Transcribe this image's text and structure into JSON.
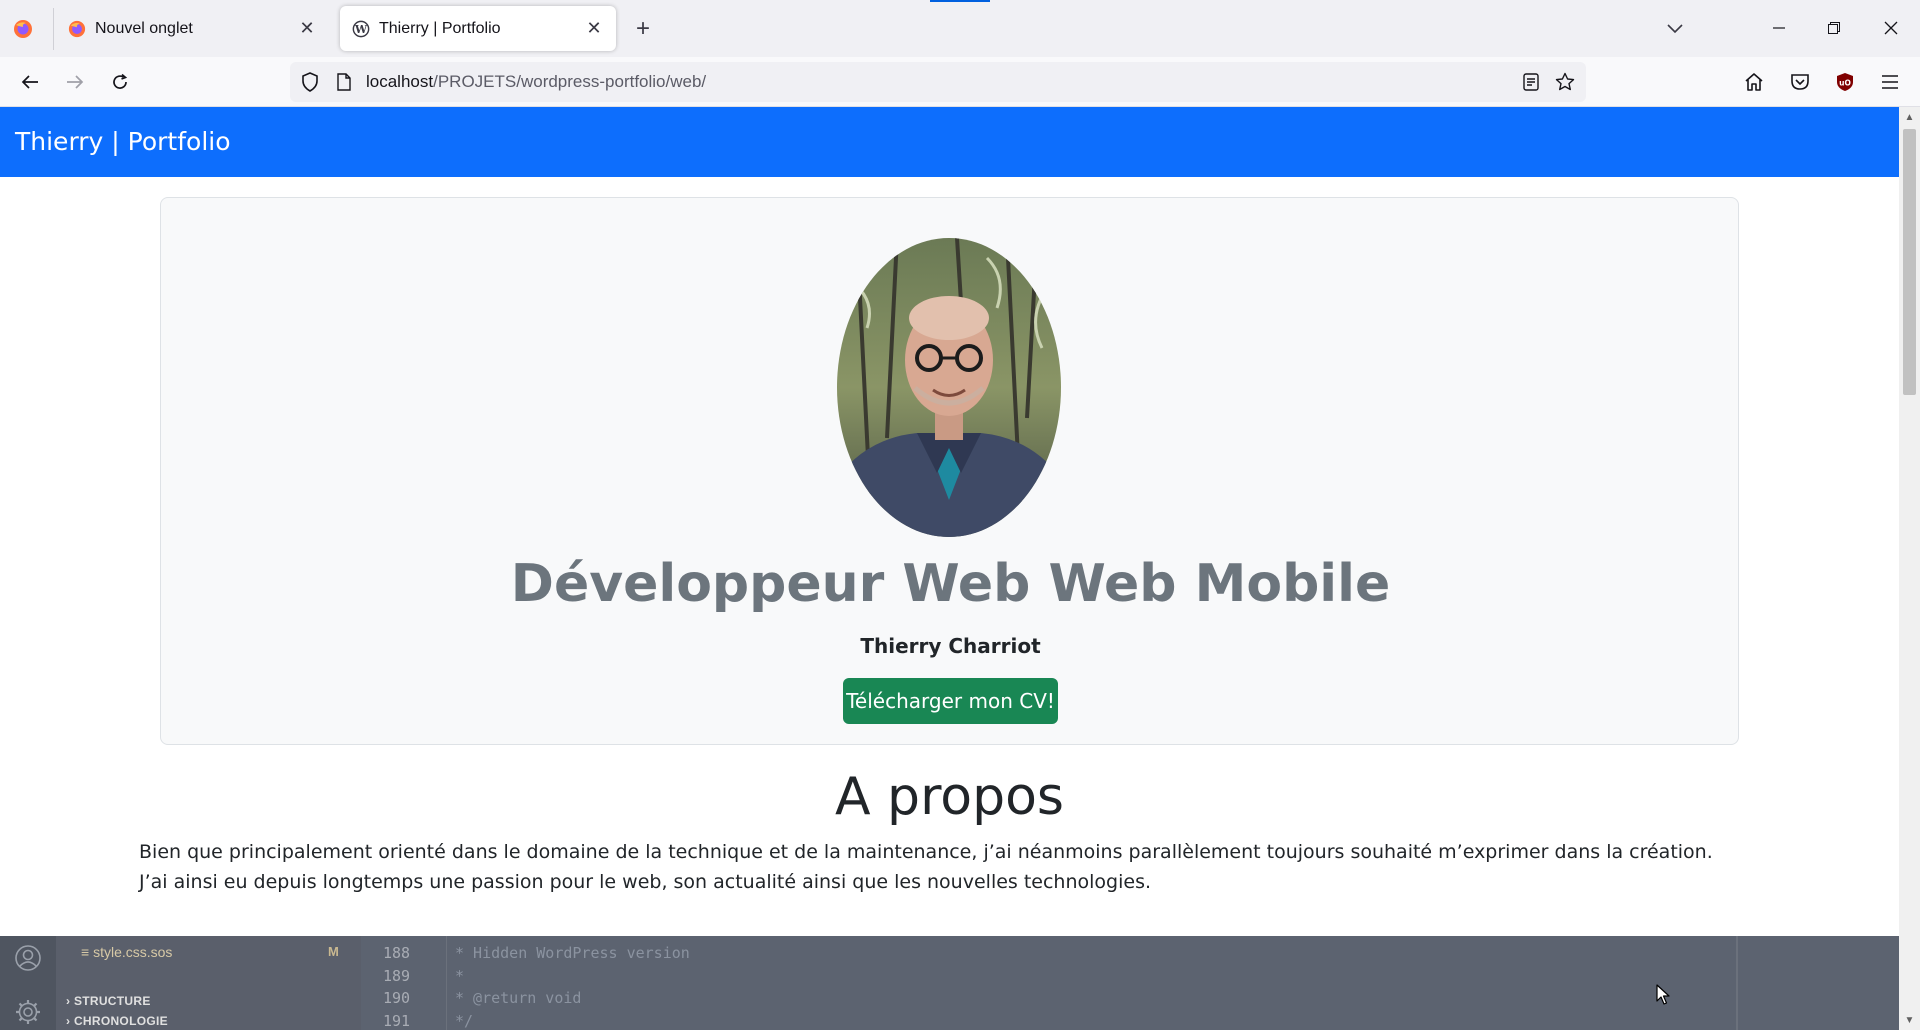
{
  "browser": {
    "tabs": [
      {
        "title": "Nouvel onglet",
        "active": false,
        "icon": "firefox-icon"
      },
      {
        "title": "Thierry | Portfolio",
        "active": true,
        "icon": "wordpress-icon"
      }
    ],
    "url": {
      "host": "localhost",
      "path": "/PROJETS/wordpress-portfolio/web/"
    }
  },
  "site": {
    "brand": "Thierry | Portfolio",
    "hero": {
      "title": "Développeur Web Web Mobile",
      "subtitle": "Thierry Charriot",
      "cv_button": "Télécharger mon CV!"
    },
    "about": {
      "title": "A propos",
      "line1": "Bien que principalement orienté dans le domaine de la technique et de la maintenance, j’ai néanmoins parallèlement toujours souhaité m’exprimer dans la création.",
      "line2": "J’ai ainsi eu depuis longtemps une passion pour le web, son actualité ainsi que les nouvelles technologies."
    }
  },
  "editor": {
    "file": "style.css.sos",
    "file_status": "M",
    "sections": [
      "STRUCTURE",
      "CHRONOLOGIE"
    ],
    "lines": [
      {
        "num": "188",
        "text": "* Hidden WordPress version"
      },
      {
        "num": "189",
        "text": "*"
      },
      {
        "num": "190",
        "text": "* @return void"
      },
      {
        "num": "191",
        "text": "*/"
      }
    ]
  },
  "colors": {
    "navbar": "#0d6efd",
    "cv_button": "#198754",
    "hero_title": "#6c757d"
  }
}
